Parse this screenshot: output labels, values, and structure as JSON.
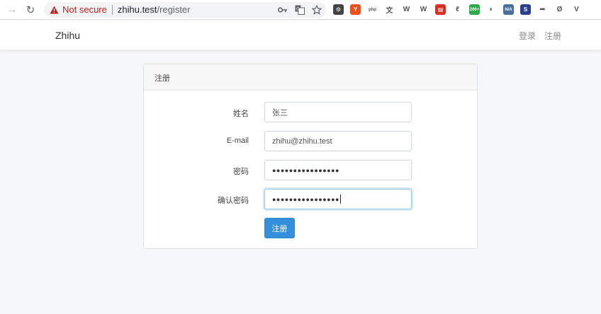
{
  "browser": {
    "security_label": "Not secure",
    "url_host": "zhihu.test",
    "url_path": "/register",
    "extensions": [
      {
        "name": "gear-ext-icon",
        "color": "#444444",
        "glyph": "⚙"
      },
      {
        "name": "redux-ext-icon",
        "color": "#e8501d",
        "glyph": "Y"
      },
      {
        "name": "php-ext-icon",
        "color": "#ffffff",
        "glyph": "php"
      },
      {
        "name": "translate-ext-icon",
        "color": "#ffffff",
        "glyph": "文"
      },
      {
        "name": "wordpress-ext-icon",
        "color": "#ffffff",
        "glyph": "W"
      },
      {
        "name": "wordpress2-ext-icon",
        "color": "#ffffff",
        "glyph": "W"
      },
      {
        "name": "red-ext-icon",
        "color": "#d93025",
        "glyph": "▤"
      },
      {
        "name": "leaf-ext-icon",
        "color": "#ffffff",
        "glyph": "ℓ"
      },
      {
        "name": "counter-ext-icon",
        "color": "#2ea84a",
        "glyph": "200+"
      },
      {
        "name": "moon-ext-icon",
        "color": "#ffffff",
        "glyph": "◐"
      },
      {
        "name": "na-ext-icon",
        "color": "#4a6f9a",
        "glyph": "N/A"
      },
      {
        "name": "s-ext-icon",
        "color": "#2c3e8c",
        "glyph": "S"
      },
      {
        "name": "arrow-ext-icon",
        "color": "#ffffff",
        "glyph": "➦"
      },
      {
        "name": "o-ext-icon",
        "color": "#ffffff",
        "glyph": "Ø"
      },
      {
        "name": "vue-ext-icon",
        "color": "#ffffff",
        "glyph": "V"
      }
    ]
  },
  "navbar": {
    "brand": "Zhihu",
    "login": "登录",
    "register": "注册"
  },
  "card": {
    "title": "注册",
    "fields": {
      "name_label": "姓名",
      "name_value": "张三",
      "email_label": "E-mail",
      "email_value": "zhihu@zhihu.test",
      "password_label": "密码",
      "password_value": "●●●●●●●●●●●●●●●●",
      "confirm_label": "确认密码",
      "confirm_value": "●●●●●●●●●●●●●●●●"
    },
    "submit": "注册"
  },
  "colors": {
    "primary": "#3490dc",
    "warning": "#c5221f"
  }
}
